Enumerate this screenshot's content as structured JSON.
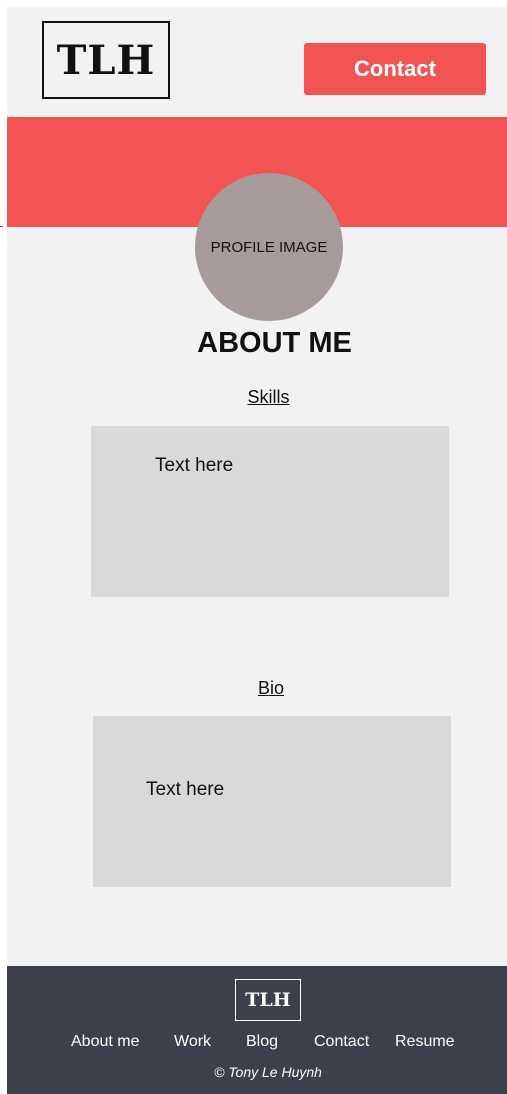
{
  "header": {
    "logo_text": "TLH",
    "contact_label": "Contact"
  },
  "hero": {
    "profile_label": "PROFILE IMAGE"
  },
  "about": {
    "title": "ABOUT ME",
    "skills": {
      "label": "Skills",
      "text": "Text here"
    },
    "bio": {
      "label": "Bio",
      "text": "Text here"
    }
  },
  "footer": {
    "logo_text": "TLH",
    "links": [
      "About me",
      "Work",
      "Blog",
      "Contact",
      "Resume"
    ],
    "copyright": "© Tony Le Huynh"
  },
  "colors": {
    "accent": "#f25454",
    "background": "#f2f2f2",
    "footer": "#3d404c",
    "placeholder_box": "#d9d9d9",
    "profile_circle": "#a69a9a"
  }
}
